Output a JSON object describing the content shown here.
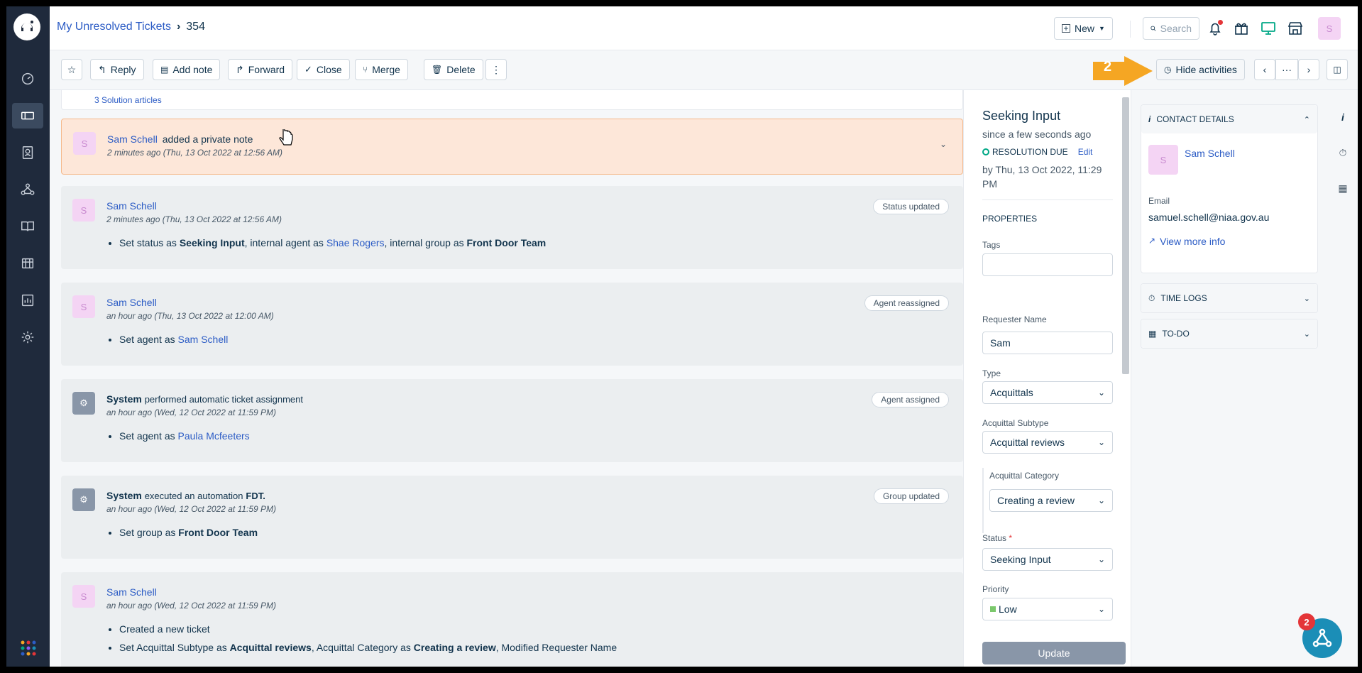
{
  "breadcrumb": {
    "parent": "My Unresolved Tickets",
    "ticket_id": "354"
  },
  "header": {
    "new_label": "New",
    "search_placeholder": "Search",
    "user_initial": "S"
  },
  "toolbar": {
    "reply": "Reply",
    "add_note": "Add note",
    "forward": "Forward",
    "close": "Close",
    "merge": "Merge",
    "delete": "Delete",
    "hide_activities": "Hide activities",
    "step_number": "2"
  },
  "solution_link": "3 Solution articles",
  "note": {
    "author": "Sam Schell",
    "action": "added a private note",
    "time": "2 minutes ago (Thu, 13 Oct 2022 at 12:56 AM)",
    "initial": "S"
  },
  "activities": [
    {
      "author": "Sam Schell",
      "time": "2 minutes ago (Thu, 13 Oct 2022 at 12:56 AM)",
      "badge": "Status updated",
      "c1": "Set status as ",
      "c2": "Seeking Input",
      "c3": ", internal agent as ",
      "c4": "Shae Rogers",
      "c5": ", internal group as ",
      "c6": "Front Door Team"
    },
    {
      "author": "Sam Schell",
      "time": "an hour ago (Thu, 13 Oct 2022 at 12:00 AM)",
      "badge": "Agent reassigned",
      "c1": "Set agent as ",
      "c2": "Sam Schell"
    },
    {
      "author": "System",
      "action": "performed automatic ticket assignment",
      "time": "an hour ago (Wed, 12 Oct 2022 at 11:59 PM)",
      "badge": "Agent assigned",
      "c1": "Set agent as ",
      "c2": "Paula Mcfeeters"
    },
    {
      "author": "System",
      "action": "executed an automation",
      "action_target": "FDT.",
      "time": "an hour ago (Wed, 12 Oct 2022 at 11:59 PM)",
      "badge": "Group updated",
      "c1": "Set group as ",
      "c2": "Front Door Team"
    },
    {
      "author": "Sam Schell",
      "time": "an hour ago (Wed, 12 Oct 2022 at 11:59 PM)",
      "l1": "Created a new ticket",
      "l2a": "Set Acquittal Subtype as ",
      "l2b": "Acquittal reviews",
      "l2c": ", Acquittal Category as ",
      "l2d": "Creating a review",
      "l2e": ", Modified Requester Name"
    }
  ],
  "properties": {
    "status_title": "Seeking Input",
    "since": "since a few seconds ago",
    "resolution_due": "RESOLUTION DUE",
    "edit": "Edit",
    "due_by": "by Thu, 13 Oct 2022, 11:29 PM",
    "heading": "PROPERTIES",
    "tags_label": "Tags",
    "tags_value": "",
    "requester_label": "Requester Name",
    "requester_value": "Sam",
    "type_label": "Type",
    "type_value": "Acquittals",
    "subtype_label": "Acquittal Subtype",
    "subtype_value": "Acquittal reviews",
    "category_label": "Acquittal Category",
    "category_value": "Creating a review",
    "status_label": "Status",
    "required_mark": "*",
    "status_value": "Seeking Input",
    "priority_label": "Priority",
    "priority_value": "Low",
    "update_button": "Update"
  },
  "contact": {
    "heading": "CONTACT DETAILS",
    "name": "Sam Schell",
    "initial": "S",
    "email_label": "Email",
    "email": "samuel.schell@niaa.gov.au",
    "more": "View more info"
  },
  "time_logs": "TIME LOGS",
  "todo": "TO-DO",
  "fab_count": "2",
  "colors": {
    "accent": "#2c5cc5",
    "nav_bg": "#1f2a3c",
    "note_bg": "#fde7d9",
    "hint_arrow": "#f5a623",
    "green_dot": "#00a886"
  }
}
